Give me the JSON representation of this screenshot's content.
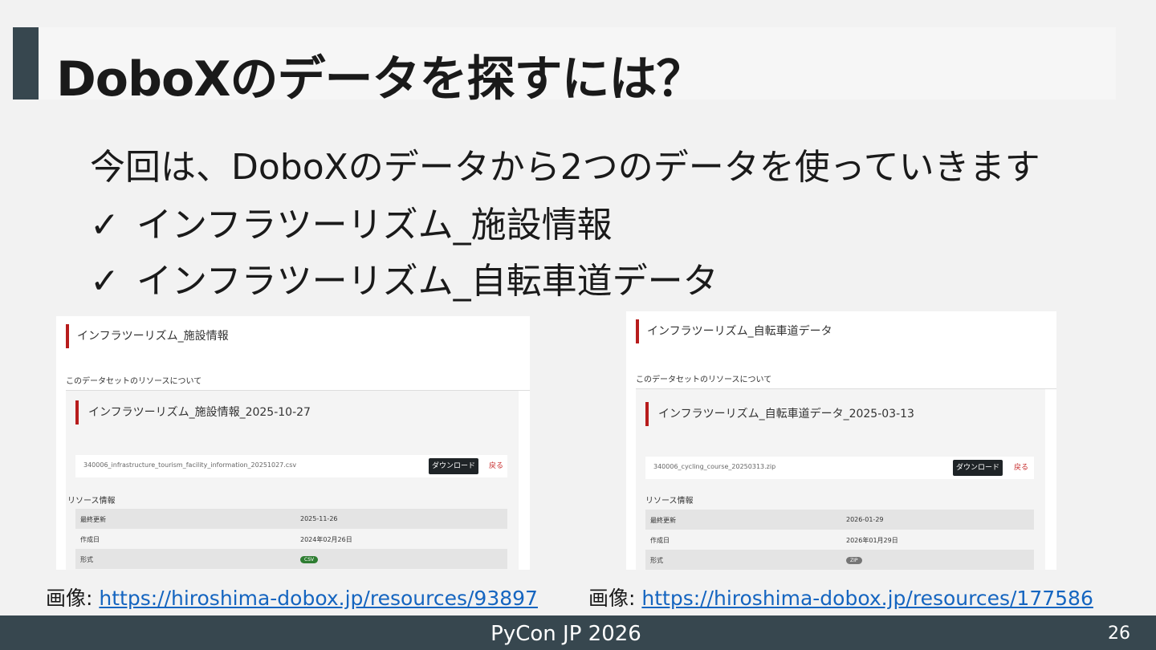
{
  "slide": {
    "title": "DoboXのデータを探すには？",
    "lines": [
      "今回は、DoboXのデータから2つのデータを使っていきます",
      "インフラツーリズム_施設情報",
      "インフラツーリズム_自転車道データ"
    ],
    "check_mark": "✓"
  },
  "screenshot_left": {
    "heading": "インフラツーリズム_施設情報",
    "section_label": "このデータセットのリソースについて",
    "resource_title": "インフラツーリズム_施設情報_2025-10-27",
    "file_name": "340006_infrastructure_tourism_facility_information_20251027.csv",
    "download_label": "ダウンロード",
    "back_label": "戻る",
    "info_label": "リソース情報",
    "rows": [
      {
        "key": "最終更新",
        "value": "2025-11-26"
      },
      {
        "key": "作成日",
        "value": "2024年02月26日"
      },
      {
        "key": "形式",
        "badge": "CSV"
      }
    ],
    "badge_color": "#2e7d32"
  },
  "screenshot_right": {
    "heading": "インフラツーリズム_自転車道データ",
    "section_label": "このデータセットのリソースについて",
    "resource_title": "インフラツーリズム_自転車道データ_2025-03-13",
    "file_name": "340006_cycling_course_20250313.zip",
    "download_label": "ダウンロード",
    "back_label": "戻る",
    "info_label": "リソース情報",
    "rows": [
      {
        "key": "最終更新",
        "value": "2026-01-29"
      },
      {
        "key": "作成日",
        "value": "2026年01月29日"
      },
      {
        "key": "形式",
        "badge": "ZIP"
      }
    ],
    "badge_color": "#757575"
  },
  "captions": {
    "left_prefix": "画像: ",
    "left_url": "https://hiroshima-dobox.jp/resources/93897",
    "right_prefix": "画像: ",
    "right_url": "https://hiroshima-dobox.jp/resources/177586"
  },
  "footer": {
    "text": "PyCon JP 2026",
    "page_number": "26"
  },
  "colors": {
    "accent": "#37474f",
    "red_accent": "#b71c1c",
    "link": "#1565c0"
  }
}
